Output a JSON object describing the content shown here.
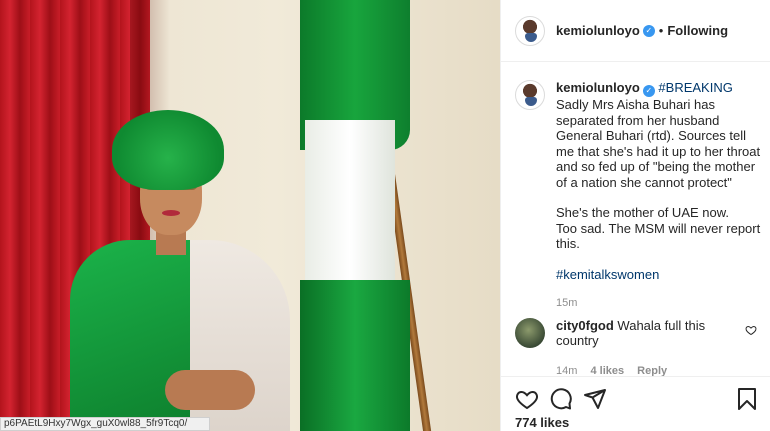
{
  "post": {
    "author": "kemiolunloyo",
    "follow_state": "Following",
    "separator": "•",
    "caption": {
      "hashtag_breaking": "#BREAKING",
      "line1": " Sadly Mrs Aisha Buhari has separated from her husband General Buhari (rtd). Sources tell me that she's had it up to her throat and so fed up of \"being the mother of a nation she cannot protect\"",
      "para2_line1": "She's the mother of UAE now.",
      "para2_line2": "Too sad. The MSM will never report this.",
      "hashtag_footer": "#kemitalkswomen",
      "timestamp": "15m"
    },
    "comment": {
      "username": "city0fgod",
      "text": "Wahala full this country",
      "time": "14m",
      "likes": "4 likes",
      "reply": "Reply"
    },
    "likes_count": "774 likes"
  },
  "status_bar": {
    "url": "p6PAEtL9Hxy7Wgx_guX0wl88_5fr9Tcq0/"
  },
  "colors": {
    "link": "#00376b",
    "verified": "#3897f0",
    "muted": "#8e8e8e"
  },
  "icons": [
    "verified-badge-icon",
    "heart-icon",
    "comment-icon",
    "share-icon",
    "bookmark-icon"
  ]
}
